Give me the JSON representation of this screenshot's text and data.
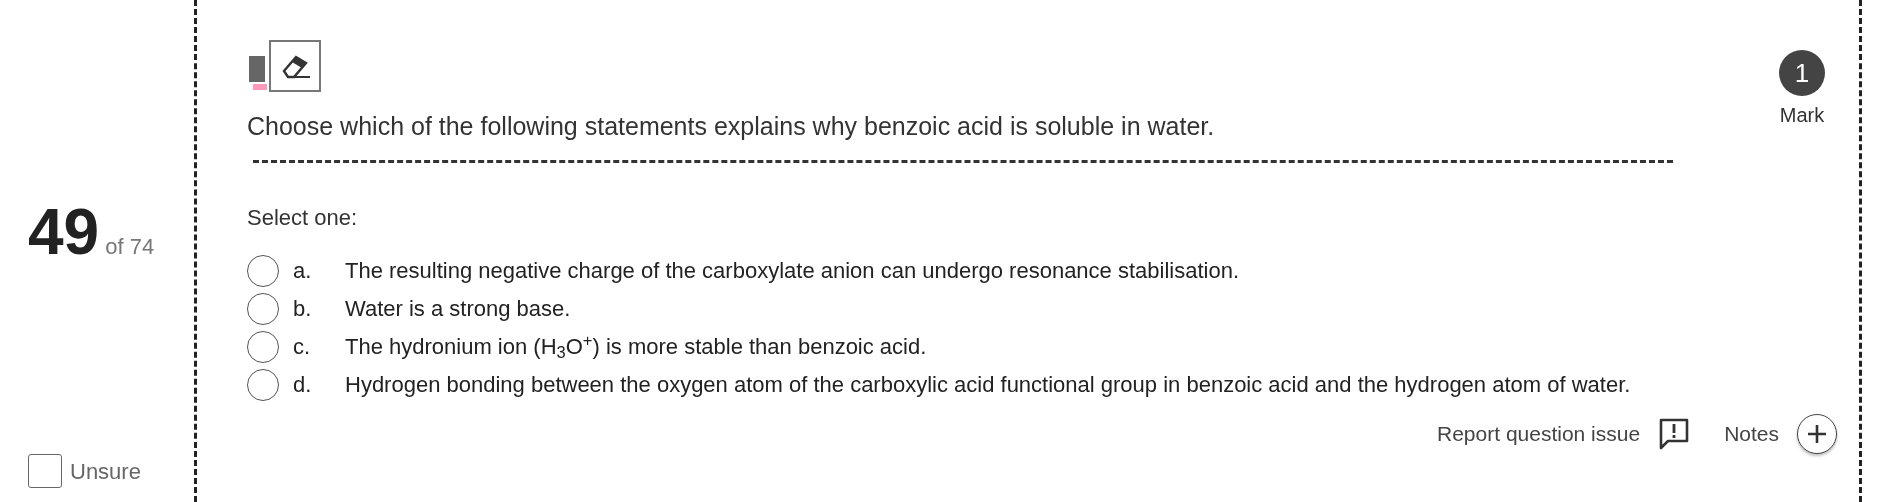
{
  "question_info": {
    "number": "49",
    "of_label": "of 74",
    "unsure": {
      "label": "Unsure",
      "checked": false
    }
  },
  "question": {
    "text": "Choose which of the following statements explains why benzoic acid is soluble in water.",
    "marks": "1",
    "marks_label": "Mark"
  },
  "prompt": "Select one:",
  "options": [
    {
      "letter": "a.",
      "text": "The resulting negative charge of the carboxylate anion can undergo resonance stabilisation.",
      "selected": false
    },
    {
      "letter": "b.",
      "text": "Water is a strong base.",
      "selected": false
    },
    {
      "letter": "c.",
      "text": "The hydronium ion (H$_{3}$O$^{+}$) is more stable than benzoic acid.",
      "selected": false
    },
    {
      "letter": "d.",
      "text": "Hydrogen bonding between the oxygen atom of the carboxylic acid functional group in benzoic acid and the hydrogen atom of water.",
      "selected": false
    }
  ],
  "footer": {
    "report_label": "Report question issue",
    "notes_label": "Notes"
  }
}
